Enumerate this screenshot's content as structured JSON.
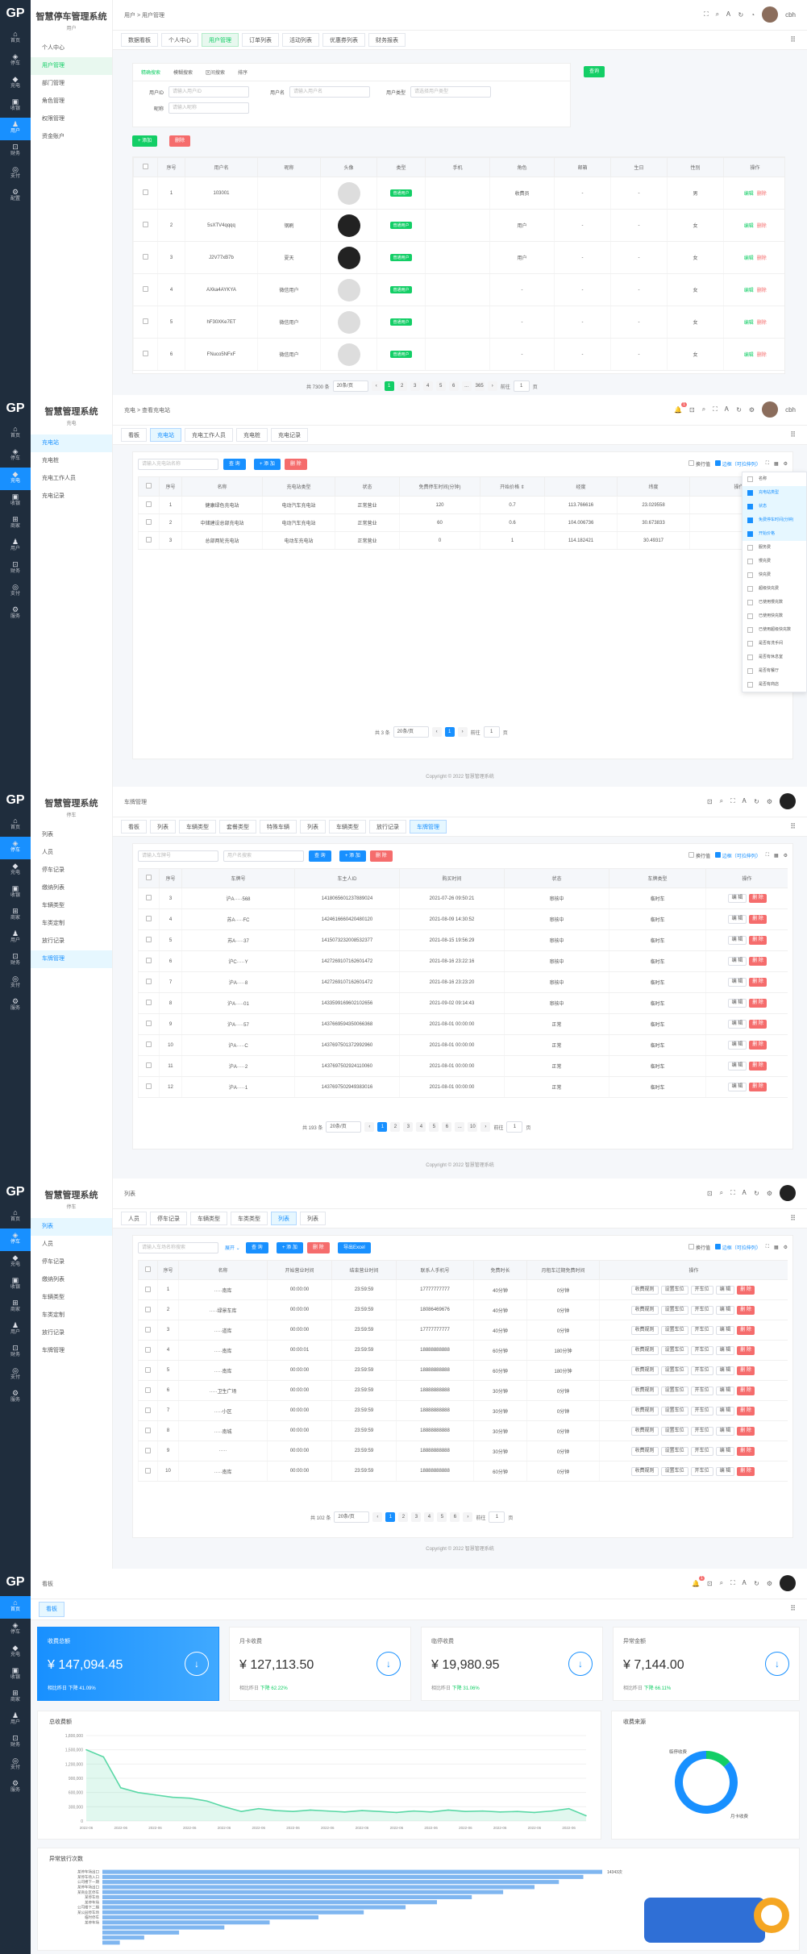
{
  "rail": {
    "logo": "GP"
  },
  "p1": {
    "title": "智慧停车管理系统",
    "subtitle": "用户",
    "rail": [
      {
        "icon": "⌂",
        "label": "首页"
      },
      {
        "icon": "◈",
        "label": "停车"
      },
      {
        "icon": "◆",
        "label": "充电"
      },
      {
        "icon": "▣",
        "label": "收银"
      },
      {
        "icon": "♟",
        "label": "用户"
      },
      {
        "icon": "⊡",
        "label": "财务"
      },
      {
        "icon": "◎",
        "label": "支付"
      },
      {
        "icon": "⚙",
        "label": "配置"
      }
    ],
    "menu": [
      "个人中心",
      "用户管理",
      "部门管理",
      "角色管理",
      "权限管理",
      "资金账户"
    ],
    "breadcrumb": "用户  >  用户管理",
    "user": "cbh",
    "tabs": [
      "数据看板",
      "个人中心",
      "用户管理",
      "订单列表",
      "活动列表",
      "优惠券列表",
      "财务报表"
    ],
    "search_tabs": [
      "精确搜索",
      "模糊搜索",
      "区间搜索",
      "排序"
    ],
    "fields": [
      {
        "label": "用户ID",
        "placeholder": "请输入用户ID"
      },
      {
        "label": "用户名",
        "placeholder": "请输入用户名"
      },
      {
        "label": "用户类型",
        "placeholder": "请选择用户类型"
      },
      {
        "label": "昵称",
        "placeholder": "请输入昵称"
      }
    ],
    "search_btn": "查询",
    "add_btn": "+ 添加",
    "del_btn": "删除",
    "columns": [
      "",
      "序号",
      "用户名",
      "昵称",
      "头像",
      "类型",
      "手机",
      "角色",
      "邮箱",
      "生日",
      "性别",
      "操作"
    ],
    "rows": [
      {
        "no": "1",
        "user": "103001",
        "nick": "",
        "dark": false,
        "type": "普通用户",
        "phone": "",
        "role": "收费员",
        "email": "-",
        "birth": "-",
        "sex": "男"
      },
      {
        "no": "2",
        "user": "5sXTV4qqqq",
        "nick": "钢刷",
        "dark": true,
        "type": "普通用户",
        "phone": "",
        "role": "用户",
        "email": "-",
        "birth": "-",
        "sex": "女"
      },
      {
        "no": "3",
        "user": "J2V77xB7b",
        "nick": "夏天",
        "dark": true,
        "type": "普通用户",
        "phone": "",
        "role": "用户",
        "email": "-",
        "birth": "-",
        "sex": "女"
      },
      {
        "no": "4",
        "user": "AXka4AYKYA",
        "nick": "微信用户",
        "dark": false,
        "type": "普通用户",
        "phone": "",
        "role": "-",
        "email": "-",
        "birth": "-",
        "sex": "女"
      },
      {
        "no": "5",
        "user": "hF30XKe7ET",
        "nick": "微信用户",
        "dark": false,
        "type": "普通用户",
        "phone": "",
        "role": "-",
        "email": "-",
        "birth": "-",
        "sex": "女"
      },
      {
        "no": "6",
        "user": "FNuco5NFxF",
        "nick": "微信用户",
        "dark": false,
        "type": "普通用户",
        "phone": "",
        "role": "-",
        "email": "-",
        "birth": "-",
        "sex": "女"
      }
    ],
    "edit": "编辑",
    "delete": "删除",
    "pager": {
      "total": "共 7300 条",
      "size": "20条/页",
      "pages": [
        "1",
        "2",
        "3",
        "4",
        "5",
        "6",
        "...",
        "365"
      ],
      "goto": "前往",
      "page": "1",
      "unit": "页"
    }
  },
  "p2": {
    "title": "智慧管理系统",
    "subtitle": "充电",
    "rail": [
      {
        "icon": "⌂",
        "label": "首页"
      },
      {
        "icon": "◈",
        "label": "停车"
      },
      {
        "icon": "◆",
        "label": "充电"
      },
      {
        "icon": "▣",
        "label": "收银"
      },
      {
        "icon": "⊞",
        "label": "商家"
      },
      {
        "icon": "♟",
        "label": "用户"
      },
      {
        "icon": "⊡",
        "label": "财务"
      },
      {
        "icon": "◎",
        "label": "支付"
      },
      {
        "icon": "⚙",
        "label": "服务"
      }
    ],
    "menu": [
      "充电站",
      "充电桩",
      "充电工作人员",
      "充电记录"
    ],
    "breadcrumb": "充电  >  查看充电站",
    "user": "cbh",
    "notif": "1",
    "tabs": [
      "看板",
      "充电站",
      "充电工作人员",
      "充电桩",
      "充电记录"
    ],
    "search_placeholder": "请输入充电站名称",
    "query_btn": "查 询",
    "add_btn": "+ 添 加",
    "del_btn": "删 除",
    "wrap_label": "换行值",
    "border_label": "边框（可拉伸列）",
    "columns": [
      "",
      "序号",
      "名称",
      "充电站类型",
      "状态",
      "免费停车时间(分钟)",
      "开始价格 ⇕",
      "经度",
      "纬度",
      "操作"
    ],
    "rows": [
      [
        "1",
        "健康绿色充电站",
        "电动汽车充电站",
        "正常营业",
        "120",
        "0.7",
        "113.766616",
        "23.029558"
      ],
      [
        "2",
        "中储建设总部充电站",
        "电动汽车充电站",
        "正常营业",
        "60",
        "0.6",
        "104.006736",
        "30.673833"
      ],
      [
        "3",
        "总部两轮充电站",
        "电动车充电站",
        "正常营业",
        "0",
        "1",
        "114.182421",
        "30.49317"
      ]
    ],
    "columns_menu": [
      {
        "label": "名称",
        "on": false
      },
      {
        "label": "充电站类型",
        "on": true
      },
      {
        "label": "状态",
        "on": true
      },
      {
        "label": "免费停车时间(分钟)",
        "on": true
      },
      {
        "label": "开始价格",
        "on": true
      },
      {
        "label": "服务费",
        "on": false
      },
      {
        "label": "慢充费",
        "on": false
      },
      {
        "label": "快充费",
        "on": false
      },
      {
        "label": "超级快充费",
        "on": false
      },
      {
        "label": "已使用慢充数",
        "on": false
      },
      {
        "label": "已使用快充数",
        "on": false
      },
      {
        "label": "已使用超级快充数",
        "on": false
      },
      {
        "label": "是否有洗手间",
        "on": false
      },
      {
        "label": "是否有休息室",
        "on": false
      },
      {
        "label": "是否有餐厅",
        "on": false
      },
      {
        "label": "是否有商店",
        "on": false
      }
    ],
    "pager": {
      "total": "共 3 条",
      "size": "20条/页",
      "pages": [
        "1"
      ],
      "goto": "前往",
      "page": "1",
      "unit": "页"
    },
    "copyright": "Copyright © 2022 智慧管理系统"
  },
  "p3": {
    "title": "智慧管理系统",
    "subtitle": "停车",
    "rail": [
      {
        "icon": "⌂",
        "label": "首页"
      },
      {
        "icon": "◈",
        "label": "停车"
      },
      {
        "icon": "◆",
        "label": "充电"
      },
      {
        "icon": "▣",
        "label": "收银"
      },
      {
        "icon": "⊞",
        "label": "商家"
      },
      {
        "icon": "♟",
        "label": "用户"
      },
      {
        "icon": "⊡",
        "label": "财务"
      },
      {
        "icon": "◎",
        "label": "支付"
      },
      {
        "icon": "⚙",
        "label": "服务"
      }
    ],
    "menu": [
      "列表",
      "人员",
      "停车记录",
      "缴纳列表",
      "车辆类型",
      "车类定制",
      "放行记录",
      "车牌管理"
    ],
    "breadcrumb": "车牌管理",
    "user": "",
    "tabs": [
      "看板",
      "列表",
      "车辆类型",
      "套餐类型",
      "特殊车辆",
      "列表",
      "车辆类型",
      "放行记录",
      "车牌管理"
    ],
    "search_a": "请输入车牌号",
    "search_b": "用户名搜索",
    "query_btn": "查 询",
    "add_btn": "+ 添 加",
    "del_btn": "删 除",
    "wrap_label": "换行值",
    "border_label": "边框（可拉伸列）",
    "columns": [
      "",
      "序号",
      "车牌号",
      "车主人ID",
      "购买时间",
      "状态",
      "车牌类型",
      "操作"
    ],
    "rows": [
      [
        "3",
        "沪A·····568",
        "1418065601237889024",
        "2021-07-26 09:50:21",
        "审核中",
        "临时车"
      ],
      [
        "4",
        "苏A·····FC",
        "1424616660420480120",
        "2021-08-09 14:30:52",
        "审核中",
        "临时车"
      ],
      [
        "5",
        "苏A·····37",
        "1415073232008532377",
        "2021-08-15 19:56:29",
        "审核中",
        "临时车"
      ],
      [
        "6",
        "沪C·····Y",
        "1427269107162601472",
        "2021-08-16 23:22:16",
        "审核中",
        "临时车"
      ],
      [
        "7",
        "沪A·····8",
        "1427269107162601472",
        "2021-08-16 23:23:20",
        "审核中",
        "临时车"
      ],
      [
        "8",
        "沪A·····01",
        "1433599169602102656",
        "2021-09-02 09:14:43",
        "审核中",
        "临时车"
      ],
      [
        "9",
        "沪A·····57",
        "1437669594350066368",
        "2021-08-01 00:00:00",
        "正常",
        "临时车"
      ],
      [
        "10",
        "沪A·····C",
        "1437697501372992960",
        "2021-08-01 00:00:00",
        "正常",
        "临时车"
      ],
      [
        "11",
        "沪A·····2",
        "1437697502924110060",
        "2021-08-01 00:00:00",
        "正常",
        "临时车"
      ],
      [
        "12",
        "沪A·····1",
        "1437697502949383016",
        "2021-08-01 00:00:00",
        "正常",
        "临时车"
      ]
    ],
    "edit": "编 辑",
    "delete": "删 除",
    "pager": {
      "total": "共 193 条",
      "size": "20条/页",
      "pages": [
        "1",
        "2",
        "3",
        "4",
        "5",
        "6",
        "...",
        "10"
      ],
      "goto": "前往",
      "page": "1",
      "unit": "页"
    },
    "copyright": "Copyright © 2022 智慧管理系统"
  },
  "p4": {
    "title": "智慧管理系统",
    "subtitle": "停车",
    "rail": [
      {
        "icon": "⌂",
        "label": "首页"
      },
      {
        "icon": "◈",
        "label": "停车"
      },
      {
        "icon": "◆",
        "label": "充电"
      },
      {
        "icon": "▣",
        "label": "收银"
      },
      {
        "icon": "⊞",
        "label": "商家"
      },
      {
        "icon": "♟",
        "label": "用户"
      },
      {
        "icon": "⊡",
        "label": "财务"
      },
      {
        "icon": "◎",
        "label": "支付"
      },
      {
        "icon": "⚙",
        "label": "服务"
      }
    ],
    "menu": [
      "列表",
      "人员",
      "停车记录",
      "缴纳列表",
      "车辆类型",
      "车类定制",
      "放行记录",
      "车牌管理"
    ],
    "breadcrumb": "列表",
    "tabs": [
      "人员",
      "停车记录",
      "车辆类型",
      "车类类型",
      "列表",
      "列表"
    ],
    "search_placeholder": "请输入车场名称搜索",
    "expand": "展开 ⌄",
    "query_btn": "查 询",
    "add_btn": "+ 添 加",
    "del_btn": "删 除",
    "export_btn": "导出Excel",
    "wrap_label": "换行值",
    "border_label": "边框（可拉伸列）",
    "columns": [
      "",
      "序号",
      "名称",
      "开始营业时间",
      "结束营业时间",
      "联系人手机号",
      "免费时长",
      "月租车过期免费时间",
      "操作"
    ],
    "rows": [
      [
        "1",
        "·····南库",
        "00:00:00",
        "23:59:59",
        "17777777777",
        "40分钟",
        "0分钟"
      ],
      [
        "2",
        "·····绿景车库",
        "00:00:00",
        "23:59:59",
        "18086469676",
        "40分钟",
        "0分钟"
      ],
      [
        "3",
        "·····道库",
        "00:00:00",
        "23:59:59",
        "17777777777",
        "40分钟",
        "0分钟"
      ],
      [
        "4",
        "·····南库",
        "00:00:01",
        "23:59:59",
        "18888888888",
        "60分钟",
        "180分钟"
      ],
      [
        "5",
        "·····南库",
        "00:00:00",
        "23:59:59",
        "18888888888",
        "60分钟",
        "180分钟"
      ],
      [
        "6",
        "·····卫生广场",
        "00:00:00",
        "23:59:59",
        "18888888888",
        "30分钟",
        "0分钟"
      ],
      [
        "7",
        "·····小区",
        "00:00:00",
        "23:59:59",
        "18888888888",
        "30分钟",
        "0分钟"
      ],
      [
        "8",
        "·····南城",
        "00:00:00",
        "23:59:59",
        "18888888888",
        "30分钟",
        "0分钟"
      ],
      [
        "9",
        "·····",
        "00:00:00",
        "23:59:59",
        "18888888888",
        "30分钟",
        "0分钟"
      ],
      [
        "10",
        "·····南库",
        "00:00:00",
        "23:59:59",
        "18888888888",
        "60分钟",
        "0分钟"
      ]
    ],
    "ops": [
      "收费规则",
      "设置车位",
      "开车位",
      "编 辑",
      "删 除"
    ],
    "pager": {
      "total": "共 102 条",
      "size": "20条/页",
      "pages": [
        "1",
        "2",
        "3",
        "4",
        "5",
        "6"
      ],
      "goto": "前往",
      "page": "1",
      "unit": "页"
    },
    "copyright": "Copyright © 2022 智慧管理系统"
  },
  "p5": {
    "rail": [
      {
        "icon": "⌂",
        "label": "首页"
      },
      {
        "icon": "◈",
        "label": "停车"
      },
      {
        "icon": "◆",
        "label": "充电"
      },
      {
        "icon": "▣",
        "label": "收银"
      },
      {
        "icon": "⊞",
        "label": "商家"
      },
      {
        "icon": "♟",
        "label": "用户"
      },
      {
        "icon": "⊡",
        "label": "财务"
      },
      {
        "icon": "◎",
        "label": "支付"
      },
      {
        "icon": "⚙",
        "label": "服务"
      }
    ],
    "breadcrumb": "看板",
    "notif": "1",
    "tab": "看板",
    "stats": [
      {
        "label": "收费总额",
        "value": "¥ 147,094.45",
        "cmp": "相比昨日",
        "delta": "下降 41.09%"
      },
      {
        "label": "月卡收费",
        "value": "¥ 127,113.50",
        "cmp": "相比昨日",
        "delta": "下降 62.22%"
      },
      {
        "label": "临停收费",
        "value": "¥ 19,980.95",
        "cmp": "相比昨日",
        "delta": "下降 31.06%"
      },
      {
        "label": "异常金额",
        "value": "¥ 7,144.00",
        "cmp": "相比昨日",
        "delta": "下降 66.11%"
      }
    ],
    "income_title": "总收费额",
    "source_title": "收费来源",
    "source_labels": [
      "临停收费",
      "月卡收费"
    ],
    "rank_title": "异常放行次数",
    "rank_value": "14343次",
    "rank_labels": [
      "某停车场出口",
      "某停车场入口",
      "公司楼下一期",
      "某停车场出口",
      "某商业区停车",
      "某停车场",
      "某停车场",
      "公司楼下二期",
      "某公园停车场",
      "临时停车",
      "某停车场"
    ],
    "colors": {
      "blue": "#1890ff",
      "green": "#13ce66",
      "line": "#5ad8a6"
    }
  },
  "chart_data": [
    {
      "type": "line",
      "title": "总收费额",
      "x": [
        "2022-06",
        "2022-06",
        "2022-06",
        "2022-06",
        "2022-06",
        "2022-06",
        "2022-06",
        "2022-06",
        "2022-06",
        "2022-06",
        "2022-06",
        "2022-06",
        "2022-06",
        "2022-06",
        "2022-06",
        "2022-06",
        "2022-06",
        "2022-06",
        "2022-06",
        "2022-06",
        "2022-06",
        "2022-06",
        "2022-06",
        "2022-06",
        "2022-06",
        "2022-06",
        "2022-06",
        "2022-06",
        "2022-06",
        "2022-06"
      ],
      "yticks": [
        "1,800,000",
        "1,500,000",
        "1,200,000",
        "900,000",
        "600,000",
        "300,000",
        "0"
      ],
      "values": [
        1500000,
        1350000,
        700000,
        600000,
        550000,
        500000,
        480000,
        420000,
        300000,
        200000,
        260000,
        220000,
        200000,
        230000,
        210000,
        190000,
        220000,
        200000,
        180000,
        210000,
        190000,
        230000,
        200000,
        210000,
        190000,
        200000,
        180000,
        210000,
        260000,
        110000
      ],
      "ylim": [
        0,
        1800000
      ]
    },
    {
      "type": "pie",
      "title": "收费来源",
      "labels": [
        "临停收费",
        "月卡收费"
      ],
      "values": [
        19980.95,
        127113.5
      ]
    },
    {
      "type": "bar",
      "title": "异常放行次数",
      "values": [
        14343,
        13800,
        13100,
        12400,
        11500,
        10600,
        9600,
        8700,
        7500,
        6200,
        4800,
        3500,
        2200,
        1200,
        500
      ]
    }
  ]
}
